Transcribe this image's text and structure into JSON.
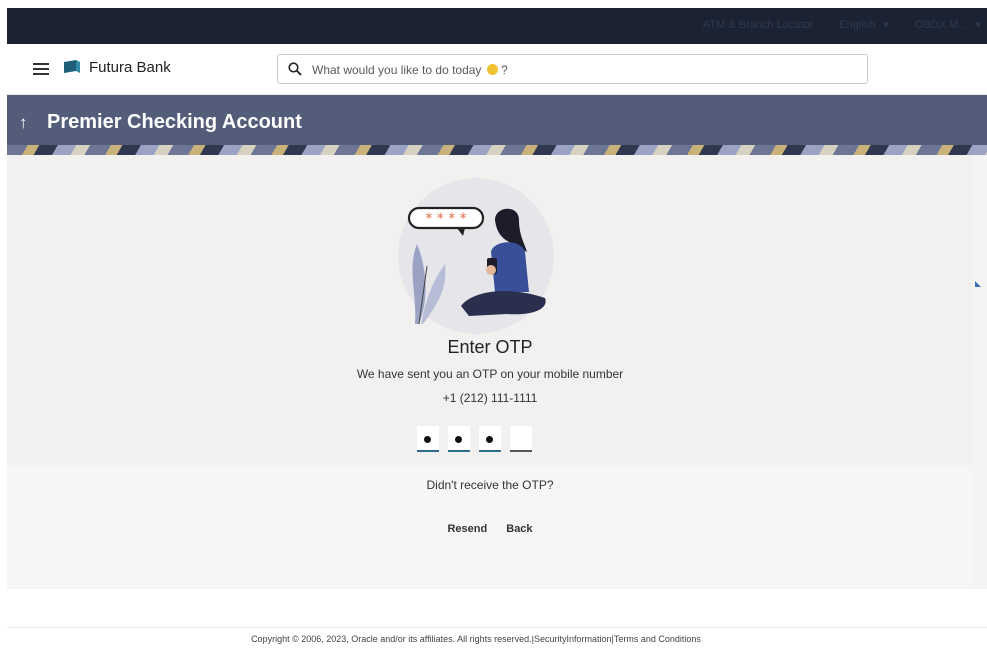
{
  "topbar": {
    "links": [
      "ATM & Branch Locator",
      "English",
      "OBDX M..."
    ]
  },
  "header": {
    "brand": "Futura Bank",
    "search_placeholder": "What would you like to do today",
    "search_suffix": "?"
  },
  "banner": {
    "title": "Premier Checking Account"
  },
  "otp_page": {
    "heading": "Enter OTP",
    "message": "We have sent you an OTP on your mobile number",
    "phone": "+1 (212) 111-1111",
    "otp_digits_filled": 3,
    "otp_length": 4,
    "not_received": "Didn't receive the OTP?",
    "resend_label": "Resend",
    "back_label": "Back"
  },
  "footer": {
    "text": "Copyright © 2006, 2023, Oracle and/or its affiliates. All rights reserved.|SecurityInformation|Terms and Conditions"
  },
  "colors": {
    "topbar_bg": "#1b2232",
    "banner_bg": "#535d7a",
    "otp_underline": "#2e6d8e",
    "content_bg": "#f2f1ef"
  }
}
